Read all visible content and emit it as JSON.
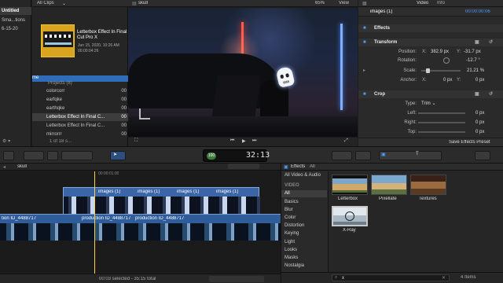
{
  "library": {
    "items": [
      {
        "label": "Untitled",
        "selected": true
      },
      {
        "label": "Sma...tions",
        "selected": false
      },
      {
        "label": "6-15-20",
        "selected": false
      }
    ]
  },
  "browser": {
    "filter_label": "All Clips",
    "clip": {
      "title": "Letterbox Effect In Final Cut Pro X",
      "date": "Jun 15, 2020, 10:26 AM",
      "duration": "00:00:04:26"
    },
    "projects_header": "me",
    "projects_subheader": "Projects",
    "projects_count": "(8)",
    "projects": [
      {
        "name": "colorcorr",
        "num": "00"
      },
      {
        "name": "earfqke",
        "num": "00"
      },
      {
        "name": "earthqke",
        "num": "00"
      },
      {
        "name": "Letterbox Effect In Final C...",
        "num": "00",
        "selected": true
      },
      {
        "name": "Letterbox Effect In Final C...",
        "num": "00"
      },
      {
        "name": "mirrorrr",
        "num": "00"
      }
    ],
    "footer_count": "1 of 18 s..."
  },
  "viewer": {
    "title": "skull",
    "zoom": "65%",
    "view_label": "View"
  },
  "inspector": {
    "clip_name": "images (1)",
    "timecode": "00:00:00:06",
    "tabs": [
      "Video",
      "Info"
    ],
    "sections": {
      "effects": "Effects",
      "transform": "Transform",
      "crop": "Crop"
    },
    "transform": {
      "position_label": "Position:",
      "position_x": "382.9",
      "position_x_unit": "px",
      "position_y": "-31.7",
      "position_y_unit": "px",
      "rotation_label": "Rotation:",
      "rotation_val": "-12.7",
      "rotation_unit": "°",
      "scale_label": "Scale:",
      "scale_val": "21.21",
      "scale_unit": "%",
      "anchor_label": "Anchor:",
      "anchor_x": "0",
      "anchor_x_unit": "px",
      "anchor_y": "0",
      "anchor_y_unit": "px",
      "x_label": "X:",
      "y_label": "Y:"
    },
    "crop": {
      "type_label": "Type:",
      "type_val": "Trim",
      "left_label": "Left:",
      "left_val": "0",
      "left_unit": "px",
      "right_label": "Right:",
      "right_val": "0",
      "right_unit": "px",
      "top_label": "Top:",
      "top_val": "0",
      "top_unit": "px"
    },
    "save_preset": "Save Effects Preset"
  },
  "toolbar": {
    "timecode_percent": "100",
    "timecode": "32:13"
  },
  "timeline": {
    "project": "skull",
    "ruler_mark": "00:00:01:00",
    "clip_labels": [
      "images (1)",
      "images (1)",
      "images (1)",
      "images (1)",
      "images (1)"
    ],
    "storyline_labels": [
      "tion ID_4488717",
      "production ID_4488717",
      "production ID_4488717"
    ],
    "status": "00:03 selected - 35:15 total"
  },
  "effects": {
    "title": "Effects",
    "filter": "All",
    "categories": [
      {
        "label": "All Video & Audio",
        "selected": false
      },
      {
        "label": "VIDEO",
        "selected": false,
        "header": true
      },
      {
        "label": "All",
        "selected": true
      },
      {
        "label": "Basics",
        "selected": false
      },
      {
        "label": "Blur",
        "selected": false
      },
      {
        "label": "Color",
        "selected": false
      },
      {
        "label": "Distortion",
        "selected": false
      },
      {
        "label": "Keying",
        "selected": false
      },
      {
        "label": "Light",
        "selected": false
      },
      {
        "label": "Looks",
        "selected": false
      },
      {
        "label": "Masks",
        "selected": false
      },
      {
        "label": "Nostalgia",
        "selected": false
      }
    ],
    "items": [
      {
        "label": "Letterbox"
      },
      {
        "label": "Pixellate"
      },
      {
        "label": "Textures"
      },
      {
        "label": "X-Ray"
      }
    ],
    "search_value": "x",
    "count": "4 Items"
  },
  "colors": {
    "accent": "#2f7fe6",
    "timeline_clip_blue": "#3a66a8",
    "storyline_blue": "#2f5c9a"
  }
}
